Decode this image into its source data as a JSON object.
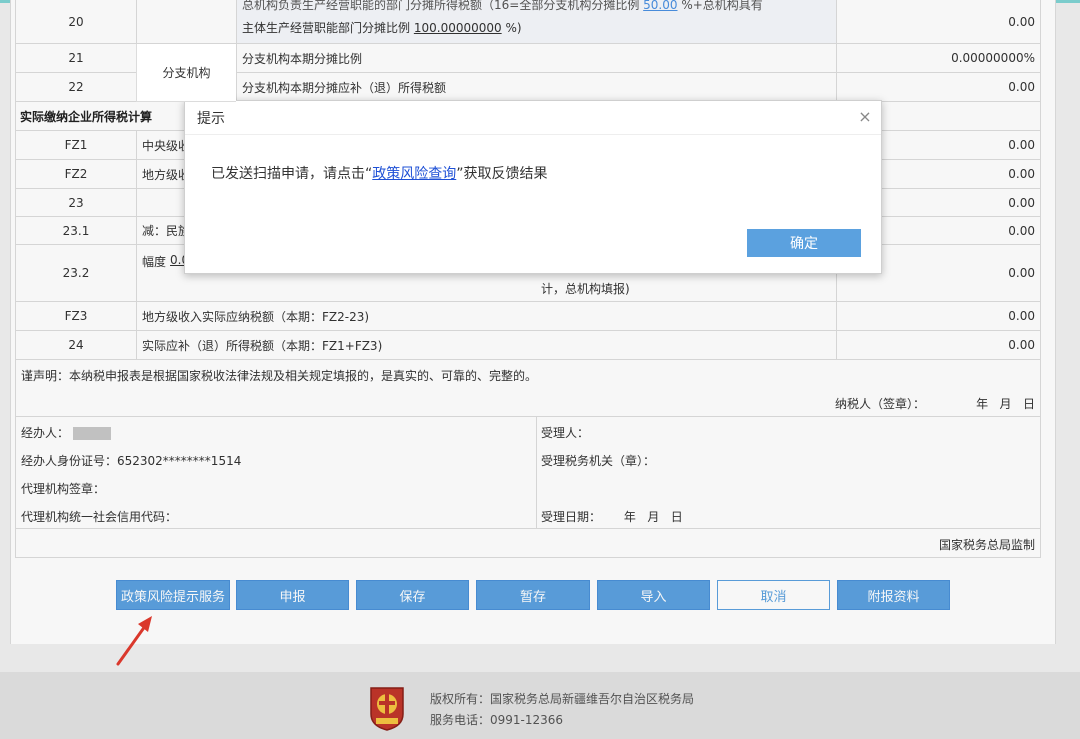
{
  "rows": {
    "r20": {
      "num": "20",
      "desc1_a": "总机构负责生产经营职能的部门分摊所得税额（16=全部分支机构分摊比例",
      "desc1_rate": "50.00",
      "desc1_b": "%+总机构具有",
      "desc2_a": "主体生产经营职能部门分摊比例",
      "desc2_rate": "100.00000000",
      "desc2_b": "%)",
      "value": "0.00"
    },
    "r21": {
      "num": "21",
      "group": "分支机构",
      "desc": "分支机构本期分摊比例",
      "value": "0.00000000%"
    },
    "r22": {
      "num": "22",
      "desc": "分支机构本期分摊应补（退）所得税额",
      "value": "0.00"
    },
    "section": "实际缴纳企业所得税计算",
    "fz1": {
      "num": "FZ1",
      "desc": "中央级收",
      "value": "0.00"
    },
    "fz2": {
      "num": "FZ2",
      "desc": "地方级收",
      "value": "0.00"
    },
    "r23": {
      "num": "23",
      "value": "0.00"
    },
    "r231": {
      "num": "23.1",
      "desc": "减：民族",
      "value": "0.00"
    },
    "r232": {
      "num": "23.2",
      "desc_a": "幅度",
      "desc_val": "0.0",
      "desc_tail": "计，总机构填报)",
      "value": "0.00"
    },
    "fz3": {
      "num": "FZ3",
      "desc": "地方级收入实际应纳税额（本期：FZ2-23)",
      "value": "0.00"
    },
    "r24": {
      "num": "24",
      "desc": "实际应补（退）所得税额（本期：FZ1+FZ3)",
      "value": "0.00"
    }
  },
  "declaration": {
    "statement": "谨声明：本纳税申报表是根据国家税收法律法规及相关规定填报的，是真实的、可靠的、完整的。",
    "taxpayer_sign": "纳税人（签章）：",
    "date": "年   月   日"
  },
  "agent": {
    "handler": "经办人：",
    "handler_id": "经办人身份证号：652302********1514",
    "agency_seal": "代理机构签章：",
    "agency_code": "代理机构统一社会信用代码：",
    "receiver": "受理人：",
    "receiving_office": "受理税务机关（章）：",
    "receive_date": "受理日期：      年   月   日"
  },
  "supervision": "国家税务总局监制",
  "buttons": {
    "risk": "政策风险提示服务",
    "declare": "申报",
    "save": "保存",
    "temp_save": "暂存",
    "import": "导入",
    "cancel": "取消",
    "attach": "附报资料"
  },
  "dialog": {
    "title": "提示",
    "msg_prefix": "已发送扫描申请，请点击“",
    "msg_link": "政策风险查询",
    "msg_suffix": "”获取反馈结果",
    "ok": "确定"
  },
  "footer": {
    "copyright": "版权所有：国家税务总局新疆维吾尔自治区税务局",
    "phone": "服务电话：0991-12366"
  },
  "colors": {
    "primary_button": "#5ba1df",
    "link": "#1e50d6",
    "arrow": "#e23a2e"
  }
}
